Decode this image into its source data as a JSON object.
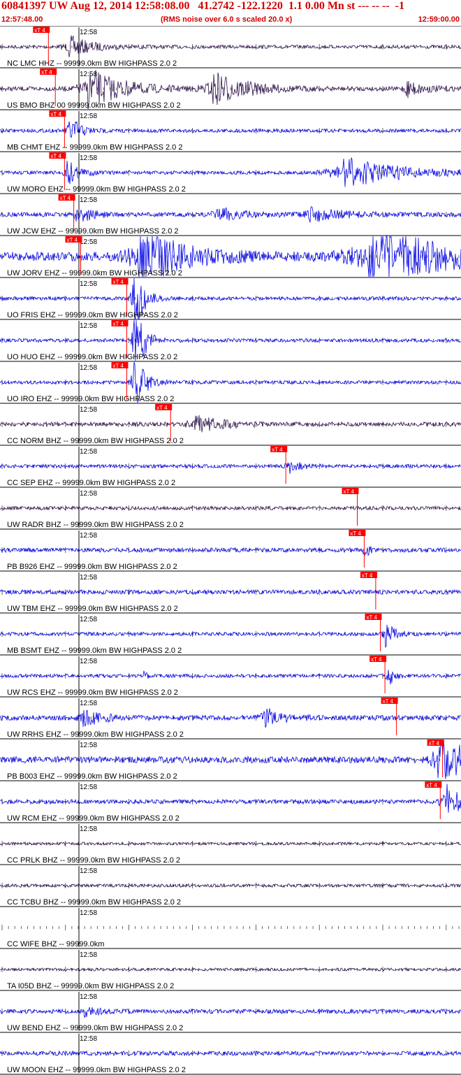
{
  "header": {
    "title": "60841397 UW Aug 12, 2014 12:58:08.00   41.2742 -122.1220  1.1 0.00 Mn st --- -- --  -1",
    "start_time": "12:57:48.00",
    "noise_note": "(RMS noise over 6.0 s scaled 20.0 x)",
    "end_time": "12:59:00.00"
  },
  "colors": {
    "title_red": "#d00000",
    "trace_blue": "#0000e6",
    "trace_dark": "#2b0f4a",
    "pick_red": "#ff0000",
    "grid": "#000000"
  },
  "minute_label": "12:58",
  "pick_label": "xT 4",
  "traces": [
    {
      "label": "NC LMC HHZ -- 99999.0km BW  HIGHPASS  2.0  2",
      "color": "dark",
      "pick": 0.105,
      "amp": 0.1,
      "bursts": [
        {
          "t": 0.15,
          "a": 0.6,
          "w": 0.04
        }
      ]
    },
    {
      "label": "US BMO BHZ 00 99999.0km BW  HIGHPASS  2.0  2",
      "color": "dark",
      "pick": 0.12,
      "amp": 0.12,
      "bursts": [
        {
          "t": 0.19,
          "a": 1.2,
          "w": 0.06
        },
        {
          "t": 0.46,
          "a": 1.0,
          "w": 0.06
        },
        {
          "t": 0.88,
          "a": 0.5,
          "w": 0.03
        }
      ]
    },
    {
      "label": "MB CHMT EHZ -- 99999.0km BW  HIGHPASS  2.0  2",
      "color": "blue",
      "pick": 0.14,
      "amp": 0.1,
      "bursts": [
        {
          "t": 0.15,
          "a": 0.9,
          "w": 0.02
        }
      ]
    },
    {
      "label": "UW MORO EHZ -- 99999.0km BW  HIGHPASS  2.0  2",
      "color": "blue",
      "pick": 0.14,
      "amp": 0.1,
      "bursts": [
        {
          "t": 0.145,
          "a": 0.8,
          "w": 0.02
        },
        {
          "t": 0.74,
          "a": 0.9,
          "w": 0.1
        }
      ]
    },
    {
      "label": "UW JCW EHZ -- 99999.0km BW  HIGHPASS  2.0  2",
      "color": "blue",
      "pick": 0.16,
      "amp": 0.12,
      "bursts": [
        {
          "t": 0.165,
          "a": 0.8,
          "w": 0.02
        },
        {
          "t": 0.47,
          "a": 0.4,
          "w": 0.05
        },
        {
          "t": 0.67,
          "a": 0.4,
          "w": 0.06
        }
      ]
    },
    {
      "label": "UW JORV EHZ -- 99999.0km BW  HIGHPASS  2.0  2",
      "color": "blue",
      "pick": 0.175,
      "amp": 0.25,
      "bursts": [
        {
          "t": 0.3,
          "a": 1.6,
          "w": 0.08
        },
        {
          "t": 0.8,
          "a": 1.5,
          "w": 0.15
        }
      ]
    },
    {
      "label": "UO FRIS EHZ -- 99999.0km BW  HIGHPASS  2.0  2",
      "color": "blue",
      "pick": 0.275,
      "amp": 0.1,
      "bursts": [
        {
          "t": 0.29,
          "a": 3.0,
          "w": 0.015
        }
      ]
    },
    {
      "label": "UO HUO EHZ -- 99999.0km BW  HIGHPASS  2.0  2",
      "color": "blue",
      "pick": 0.275,
      "amp": 0.1,
      "bursts": [
        {
          "t": 0.29,
          "a": 3.0,
          "w": 0.015
        }
      ]
    },
    {
      "label": "UO IRO EHZ -- 99999.0km BW  HIGHPASS  2.0  2",
      "color": "blue",
      "pick": 0.275,
      "amp": 0.1,
      "bursts": [
        {
          "t": 0.29,
          "a": 2.6,
          "w": 0.015
        }
      ]
    },
    {
      "label": "CC NORM BHZ -- 99999.0km BW  HIGHPASS  2.0  2",
      "color": "dark",
      "pick": 0.37,
      "amp": 0.12,
      "bursts": [
        {
          "t": 0.42,
          "a": 0.5,
          "w": 0.05
        }
      ]
    },
    {
      "label": "CC SEP EHZ -- 99999.0km BW  HIGHPASS  2.0  2",
      "color": "blue",
      "pick": 0.62,
      "amp": 0.1,
      "bursts": [
        {
          "t": 0.625,
          "a": 0.4,
          "w": 0.02
        }
      ]
    },
    {
      "label": "UW RADR BHZ -- 99999.0km BW  HIGHPASS  2.0  2",
      "color": "dark",
      "pick": 0.775,
      "amp": 0.1,
      "bursts": []
    },
    {
      "label": "PB B926 EHZ -- 99999.0km BW  HIGHPASS  2.0  2",
      "color": "blue",
      "pick": 0.79,
      "amp": 0.12,
      "bursts": [
        {
          "t": 0.79,
          "a": 1.3,
          "w": 0.005
        }
      ]
    },
    {
      "label": "UW TBM EHZ -- 99999.0km BW  HIGHPASS  2.0  2",
      "color": "blue",
      "pick": 0.815,
      "amp": 0.12,
      "bursts": []
    },
    {
      "label": "MB BSMT EHZ -- 99999.0km BW  HIGHPASS  2.0  2",
      "color": "blue",
      "pick": 0.825,
      "amp": 0.1,
      "bursts": [
        {
          "t": 0.835,
          "a": 0.8,
          "w": 0.015
        }
      ]
    },
    {
      "label": "UW RCS EHZ -- 99999.0km BW  HIGHPASS  2.0  2",
      "color": "blue",
      "pick": 0.835,
      "amp": 0.1,
      "bursts": [
        {
          "t": 0.84,
          "a": 1.0,
          "w": 0.008
        },
        {
          "t": 0.31,
          "a": 0.4,
          "w": 0.005
        }
      ]
    },
    {
      "label": "UW RRHS EHZ -- 99999.0km BW  HIGHPASS  2.0  2",
      "color": "blue",
      "pick": 0.86,
      "amp": 0.14,
      "bursts": [
        {
          "t": 0.18,
          "a": 0.5,
          "w": 0.03
        },
        {
          "t": 0.57,
          "a": 0.6,
          "w": 0.03
        }
      ]
    },
    {
      "label": "PB B003 EHZ -- 99999.0km BW  HIGHPASS  2.0  2",
      "color": "blue",
      "pick": 0.96,
      "amp": 0.18,
      "bursts": [
        {
          "t": 0.95,
          "a": 1.3,
          "w": 0.06
        }
      ]
    },
    {
      "label": "UW RCM EHZ -- 99999.0km BW  HIGHPASS  2.0  2",
      "color": "blue",
      "pick": 0.955,
      "amp": 0.12,
      "bursts": [
        {
          "t": 0.965,
          "a": 1.0,
          "w": 0.03
        }
      ]
    },
    {
      "label": "CC PRLK BHZ -- 99999.0km BW  HIGHPASS  2.0  2",
      "color": "dark",
      "pick": null,
      "amp": 0.08,
      "bursts": []
    },
    {
      "label": "CC TCBU BHZ -- 99999.0km BW  HIGHPASS  2.0  2",
      "color": "dark",
      "pick": null,
      "amp": 0.09,
      "bursts": []
    },
    {
      "label": "CC WIFE BHZ -- 99999.0km",
      "color": "dark",
      "pick": null,
      "amp": 0.0,
      "bursts": []
    },
    {
      "label": "TA I05D BHZ -- 99999.0km BW  HIGHPASS  2.0  2",
      "color": "dark",
      "pick": null,
      "amp": 0.08,
      "bursts": []
    },
    {
      "label": "UW BEND EHZ -- 99999.0km BW  HIGHPASS  2.0  2",
      "color": "blue",
      "pick": null,
      "amp": 0.12,
      "bursts": [
        {
          "t": 0.18,
          "a": 0.4,
          "w": 0.02
        }
      ]
    },
    {
      "label": "UW MOON EHZ -- 99999.0km BW  HIGHPASS  2.0  2",
      "color": "blue",
      "pick": null,
      "amp": 0.12,
      "bursts": []
    }
  ]
}
